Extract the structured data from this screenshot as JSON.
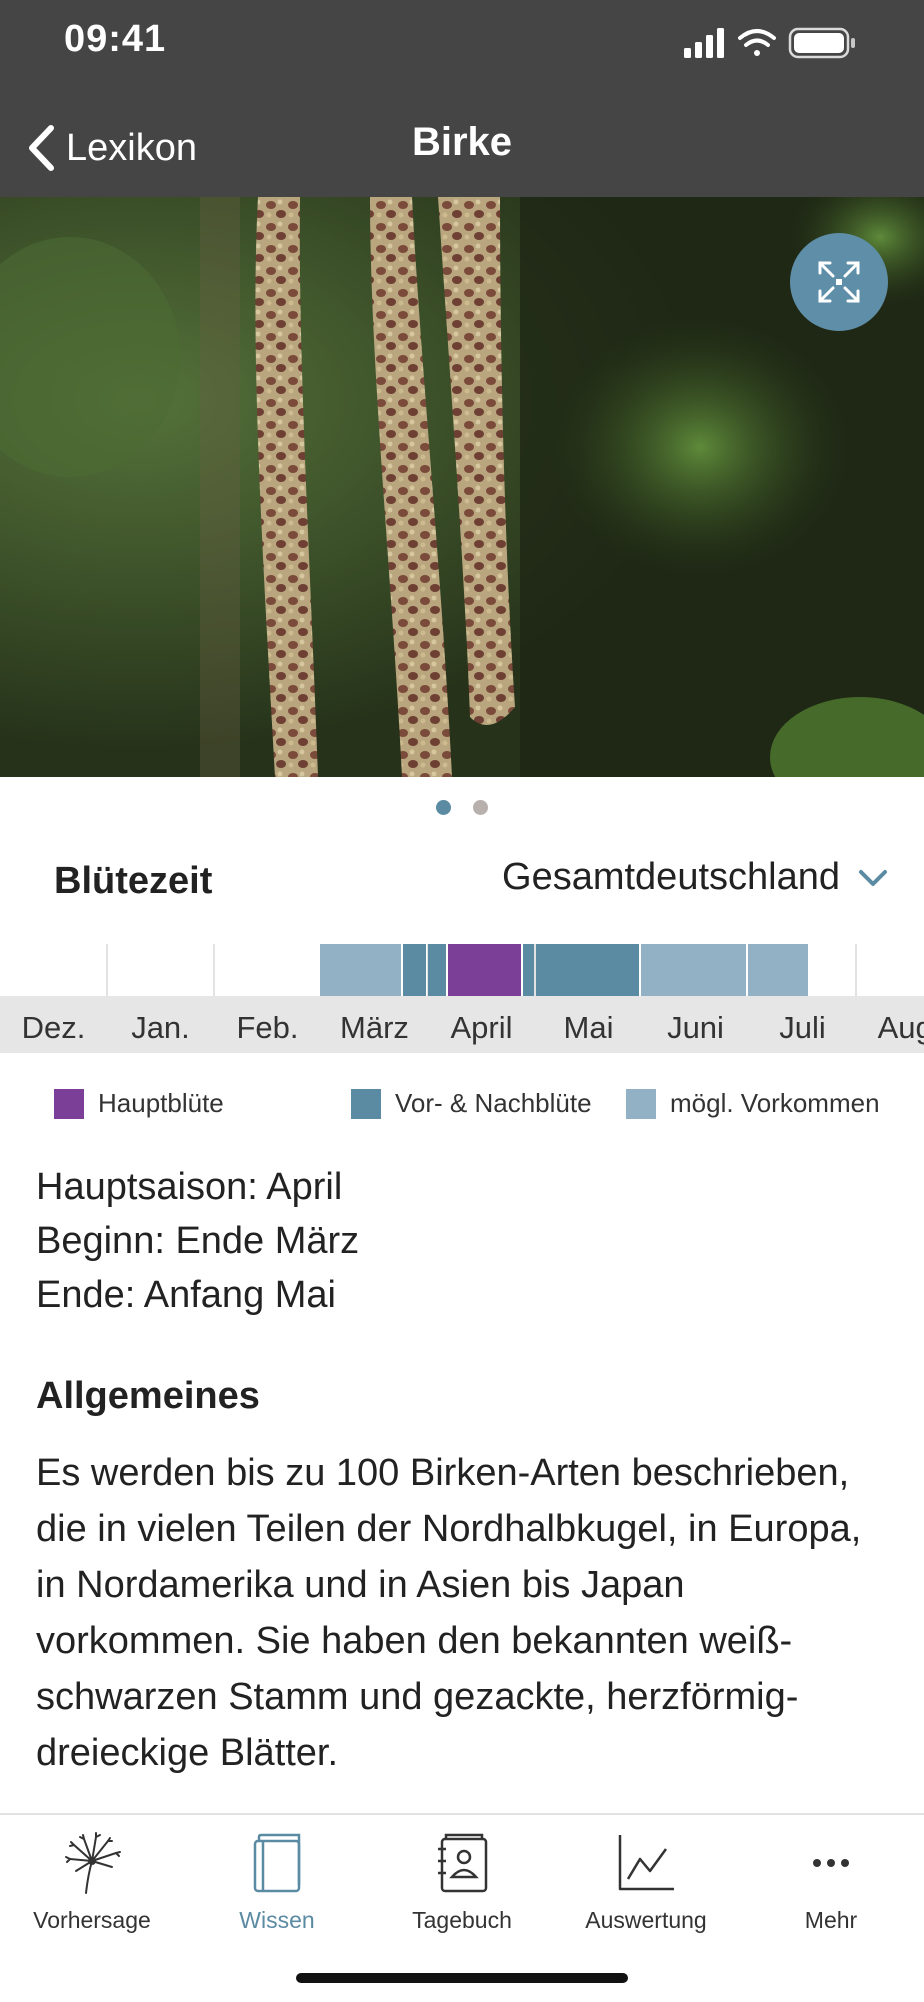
{
  "status": {
    "time": "09:41"
  },
  "nav": {
    "back_label": "Lexikon",
    "title": "Birke"
  },
  "carousel": {
    "page_count": 2,
    "active_page": 1
  },
  "bloom": {
    "title": "Blütezeit",
    "region": "Gesamtdeutschland",
    "months": [
      "Dez.",
      "Jan.",
      "Feb.",
      "März",
      "April",
      "Mai",
      "Juni",
      "Juli",
      "Aug."
    ],
    "legend": {
      "main": "Hauptblüte",
      "pre_post": "Vor- & Nachblüte",
      "possible": "mögl. Vorkommen"
    },
    "colors": {
      "main": "#7b3f98",
      "pre_post": "#5b8aa3",
      "possible": "#93b1c4"
    }
  },
  "season": {
    "main": "Hauptsaison: April",
    "start": "Beginn: Ende März",
    "end": "Ende: Anfang Mai"
  },
  "general": {
    "title": "Allgemeines",
    "text": "Es werden bis zu 100 Birken-Arten beschrieben, die in vielen Teilen der Nordhalbkugel, in Europa, in Nordamerika und in Asien bis Japan vorkommen. Sie haben den bekannten weiß-schwarzen Stamm und gezackte, herzförmig- dreieckige Blätter."
  },
  "tabs": [
    {
      "label": "Vorhersage",
      "icon": "dandelion-icon",
      "active": false
    },
    {
      "label": "Wissen",
      "icon": "book-icon",
      "active": true
    },
    {
      "label": "Tagebuch",
      "icon": "diary-icon",
      "active": false
    },
    {
      "label": "Auswertung",
      "icon": "chart-icon",
      "active": false
    },
    {
      "label": "Mehr",
      "icon": "more-icon",
      "active": false
    }
  ],
  "theme": {
    "header_bg": "#454545",
    "accent": "#5b8aa3"
  }
}
